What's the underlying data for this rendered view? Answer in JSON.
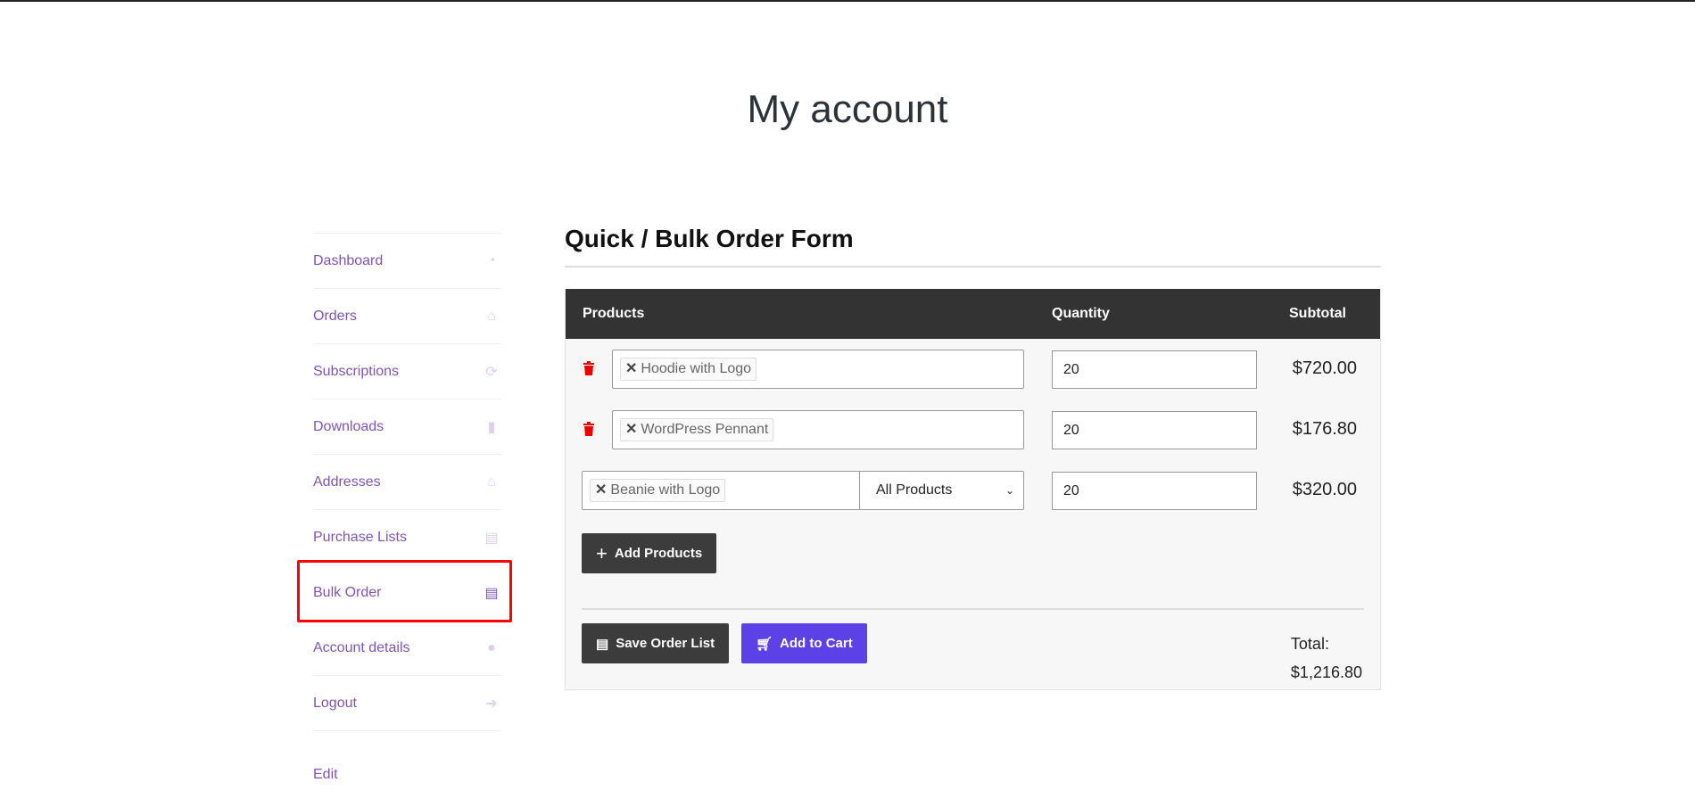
{
  "page": {
    "title": "My account"
  },
  "sidebar": {
    "items": [
      {
        "label": "Dashboard",
        "icon": "dashboard-icon"
      },
      {
        "label": "Orders",
        "icon": "basket-icon"
      },
      {
        "label": "Subscriptions",
        "icon": "refresh-icon"
      },
      {
        "label": "Downloads",
        "icon": "file-archive-icon"
      },
      {
        "label": "Addresses",
        "icon": "home-icon"
      },
      {
        "label": "Purchase Lists",
        "icon": "file-icon"
      },
      {
        "label": "Bulk Order",
        "icon": "file-text-icon",
        "active": true
      },
      {
        "label": "Account details",
        "icon": "user-icon"
      },
      {
        "label": "Logout",
        "icon": "sign-out-icon"
      },
      {
        "label": "Edit"
      }
    ]
  },
  "main": {
    "heading": "Quick / Bulk Order Form",
    "columns": {
      "products": "Products",
      "quantity": "Quantity",
      "subtotal": "Subtotal"
    },
    "rows": [
      {
        "product": "Hoodie with Logo",
        "quantity": "20",
        "subtotal": "$720.00"
      },
      {
        "product": "WordPress Pennant",
        "quantity": "20",
        "subtotal": "$176.80"
      },
      {
        "product": "Beanie with Logo",
        "category": "All Products",
        "quantity": "20",
        "subtotal": "$320.00"
      }
    ],
    "add_products": "Add Products",
    "save_order_list": "Save Order List",
    "add_to_cart": "Add to Cart",
    "total_label": "Total:",
    "total_value": "$1,216.80",
    "colors": {
      "accent": "#7f54b3",
      "cart_button": "#5b41e6",
      "delete": "#e00000",
      "header": "#333333"
    }
  }
}
